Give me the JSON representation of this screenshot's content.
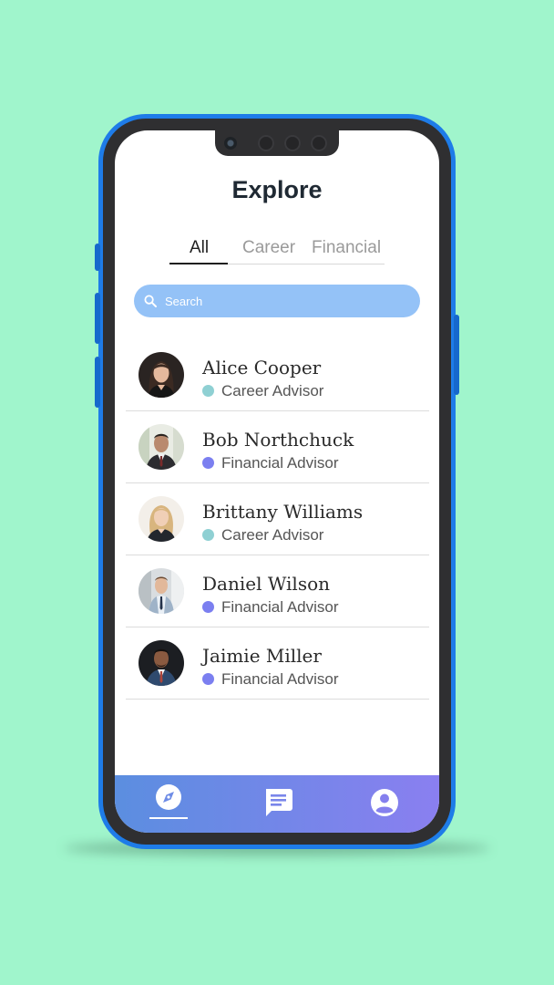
{
  "header": {
    "title": "Explore"
  },
  "tabs": [
    {
      "label": "All",
      "active": true
    },
    {
      "label": "Career",
      "active": false
    },
    {
      "label": "Financial",
      "active": false
    }
  ],
  "search": {
    "placeholder": "Search",
    "value": ""
  },
  "advisors": [
    {
      "name": "Alice Cooper",
      "role": "Career Advisor",
      "role_color": "#8fd0d3"
    },
    {
      "name": "Bob Northchuck",
      "role": "Financial Advisor",
      "role_color": "#7b7ff0"
    },
    {
      "name": "Brittany Williams",
      "role": "Career Advisor",
      "role_color": "#8fd0d3"
    },
    {
      "name": "Daniel Wilson",
      "role": "Financial Advisor",
      "role_color": "#7b7ff0"
    },
    {
      "name": "Jaimie Miller",
      "role": "Financial Advisor",
      "role_color": "#7b7ff0"
    }
  ],
  "bottom_nav": [
    {
      "icon": "compass-icon",
      "active": true
    },
    {
      "icon": "chat-icon",
      "active": false
    },
    {
      "icon": "profile-icon",
      "active": false
    }
  ],
  "colors": {
    "background": "#a0f5cc",
    "phone_frame": "#1e7ce8",
    "search_bg": "#94c2f7",
    "nav_gradient_start": "#5b8ee0",
    "nav_gradient_end": "#8a7ff0"
  }
}
